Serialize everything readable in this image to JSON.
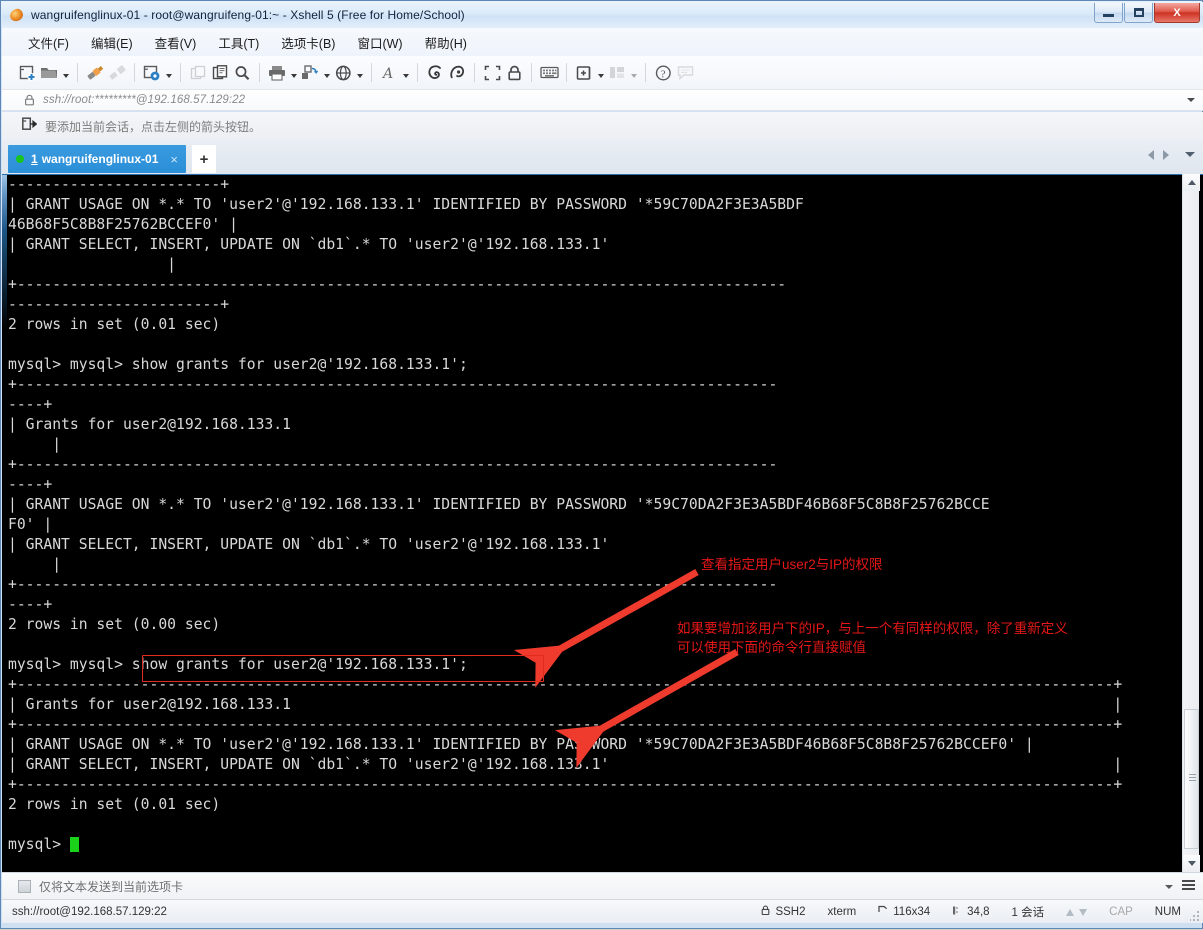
{
  "window": {
    "title": "wangruifenglinux-01 - root@wangruifeng-01:~ - Xshell 5 (Free for Home/School)",
    "icon": "xshell-leaf-icon",
    "buttons": {
      "minimize": "minimize",
      "maximize": "maximize",
      "close": "X"
    }
  },
  "menubar": {
    "items": [
      {
        "name": "file",
        "label": "文件(F)"
      },
      {
        "name": "edit",
        "label": "编辑(E)"
      },
      {
        "name": "view",
        "label": "查看(V)"
      },
      {
        "name": "tools",
        "label": "工具(T)"
      },
      {
        "name": "tabs",
        "label": "选项卡(B)"
      },
      {
        "name": "window",
        "label": "窗口(W)"
      },
      {
        "name": "help",
        "label": "帮助(H)"
      }
    ]
  },
  "toolbar": {
    "icons": [
      "new-session-icon",
      "open-folder-icon",
      "connect-icon",
      "disconnect-icon",
      "session-properties-icon",
      "copy-window-icon",
      "paste-icon",
      "find-icon",
      "print-icon",
      "transfer-icon",
      "browser-icon",
      "font-icon",
      "xftp-icon",
      "xagent-icon",
      "fullscreen-icon",
      "lock-icon",
      "keyboard-icon",
      "add-session-icon",
      "layout-icon",
      "help-icon",
      "comment-icon"
    ]
  },
  "address": {
    "icon": "lock-icon",
    "value": "ssh://root:*********@192.168.57.129:22",
    "dropdown": "chevron-down-icon"
  },
  "hint": {
    "icon": "add-session-arrow-icon",
    "text": "要添加当前会话，点击左侧的箭头按钮。"
  },
  "tabs": {
    "active": {
      "index": "1",
      "label": "wangruifenglinux-01",
      "status_dot": "connected",
      "close": "×"
    },
    "add_label": "+",
    "nav_prev": "left-arrow-icon",
    "nav_next": "right-arrow-icon",
    "menu": "chevron-down-icon"
  },
  "terminal": {
    "lines": [
      "------------------------+",
      "| GRANT USAGE ON *.* TO 'user2'@'192.168.133.1' IDENTIFIED BY PASSWORD '*59C70DA2F3E3A5BDF",
      "46B68F5C8B8F25762BCCEF0' |",
      "| GRANT SELECT, INSERT, UPDATE ON `db1`.* TO 'user2'@'192.168.133.1'",
      "                  |",
      "+---------------------------------------------------------------------------------------",
      "------------------------+",
      "2 rows in set (0.01 sec)",
      "",
      "mysql> mysql> show grants for user2@'192.168.133.1';",
      "+--------------------------------------------------------------------------------------",
      "----+",
      "| Grants for user2@192.168.133.1",
      "     |",
      "+--------------------------------------------------------------------------------------",
      "----+",
      "| GRANT USAGE ON *.* TO 'user2'@'192.168.133.1' IDENTIFIED BY PASSWORD '*59C70DA2F3E3A5BDF46B68F5C8B8F25762BCCE",
      "F0' |",
      "| GRANT SELECT, INSERT, UPDATE ON `db1`.* TO 'user2'@'192.168.133.1'",
      "     |",
      "+--------------------------------------------------------------------------------------",
      "----+",
      "2 rows in set (0.00 sec)",
      "",
      "mysql> mysql> show grants for user2@'192.168.133.1';",
      "+----------------------------------------------------------------------------------------------------------------------------+",
      "| Grants for user2@192.168.133.1                                                                                             |",
      "+----------------------------------------------------------------------------------------------------------------------------+",
      "| GRANT USAGE ON *.* TO 'user2'@'192.168.133.1' IDENTIFIED BY PASSWORD '*59C70DA2F3E3A5BDF46B68F5C8B8F25762BCCEF0' |",
      "| GRANT SELECT, INSERT, UPDATE ON `db1`.* TO 'user2'@'192.168.133.1'                                                         |",
      "+----------------------------------------------------------------------------------------------------------------------------+",
      "2 rows in set (0.01 sec)",
      "",
      "mysql> "
    ],
    "prompt": "mysql>",
    "cursor": "block-cursor"
  },
  "annotations": {
    "note1": "查看指定用户user2与IP的权限",
    "note2_line1": "如果要增加该用户下的IP，与上一个有同样的权限，除了重新定义",
    "note2_line2": "可以使用下面的命令行直接赋值",
    "highlight_color": "#e31717",
    "boxed_command": "show grants for user2@'192.168.133.1';",
    "arrow1": "red-arrow-icon",
    "arrow2": "red-arrow-icon",
    "arrow3": "red-arrow-icon"
  },
  "sendbar": {
    "icon": "send-to-tab-icon",
    "text": "仅将文本发送到当前选项卡",
    "dropdown": "chevron-down-icon",
    "menu": "hamburger-icon"
  },
  "statusbar": {
    "connection": "ssh://root@192.168.57.129:22",
    "protocol_icon": "lock-icon",
    "protocol": "SSH2",
    "terminal_type": "xterm",
    "size_icon": "resize-icon",
    "size": "116x34",
    "cursor_icon": "cursor-position-icon",
    "cursor_pos": "34,8",
    "sessions": "1 会话",
    "up_arrow": "upload-arrow-icon",
    "down_arrow": "download-arrow-icon",
    "cap": "CAP",
    "num": "NUM"
  }
}
